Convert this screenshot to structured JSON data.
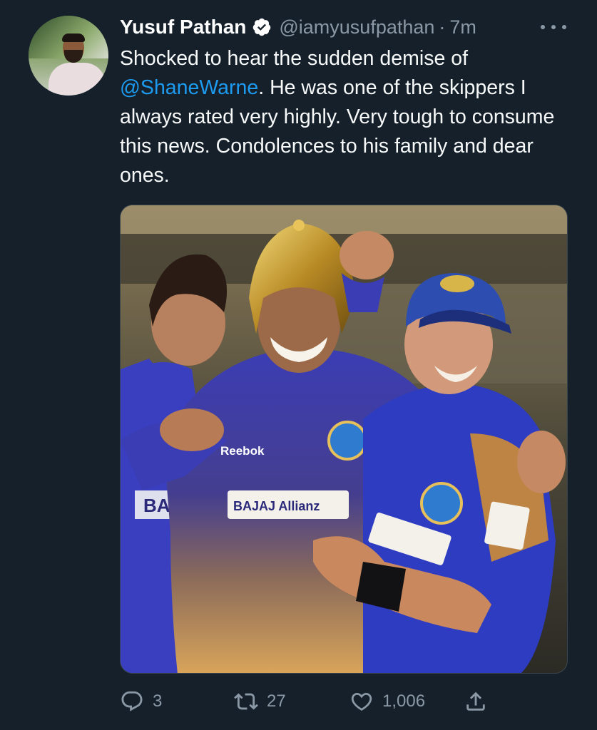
{
  "author": {
    "name": "Yusuf Pathan",
    "handle": "@iamyusufpathan",
    "separator": "·",
    "time": "7m",
    "verified_icon": "verified-badge-icon",
    "avatar_icon": "avatar-photo"
  },
  "tweet": {
    "text_before": "Shocked to hear the sudden demise of ",
    "mention": "@ShaneWarne",
    "text_after": ". He was one of the skippers I always rated very highly. Very tough to consume this news. Condolences to his family and dear ones.",
    "image_jersey_brand": "Reebok",
    "image_sponsor_text": "BAJAJ Allianz",
    "image_sponsor_fragment": "BA"
  },
  "actions": {
    "replies": "3",
    "retweets": "27",
    "likes": "1,006"
  },
  "colors": {
    "background": "#15202b",
    "text": "#f7f9f9",
    "secondary": "#8b98a5",
    "accent": "#1d9bf0",
    "jersey": "#3a3fb5"
  }
}
